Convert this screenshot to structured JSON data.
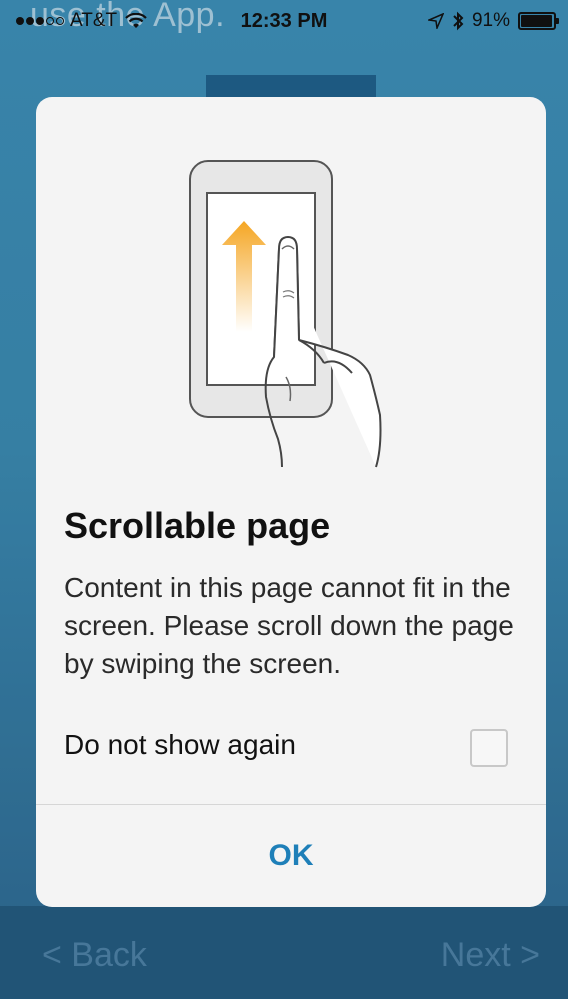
{
  "background": {
    "partial_text": "use the App.",
    "nav": {
      "back_label": "< Back",
      "next_label": "Next >"
    }
  },
  "status_bar": {
    "carrier": "AT&T",
    "time": "12:33 PM",
    "battery_percent": "91%",
    "battery_level": 0.91,
    "icons": [
      "signal-dots",
      "wifi-icon",
      "location-icon",
      "bluetooth-icon",
      "battery-icon"
    ]
  },
  "dialog": {
    "illustration_icon": "swipe-up-gesture-icon",
    "title": "Scrollable page",
    "message": "Content in this page cannot fit in the screen. Please scroll down the page by swiping the screen.",
    "option_label": "Do not show again",
    "option_checked": false,
    "ok_label": "OK",
    "accent_color": "#1e7fb8",
    "arrow_color": "#f5a623"
  }
}
